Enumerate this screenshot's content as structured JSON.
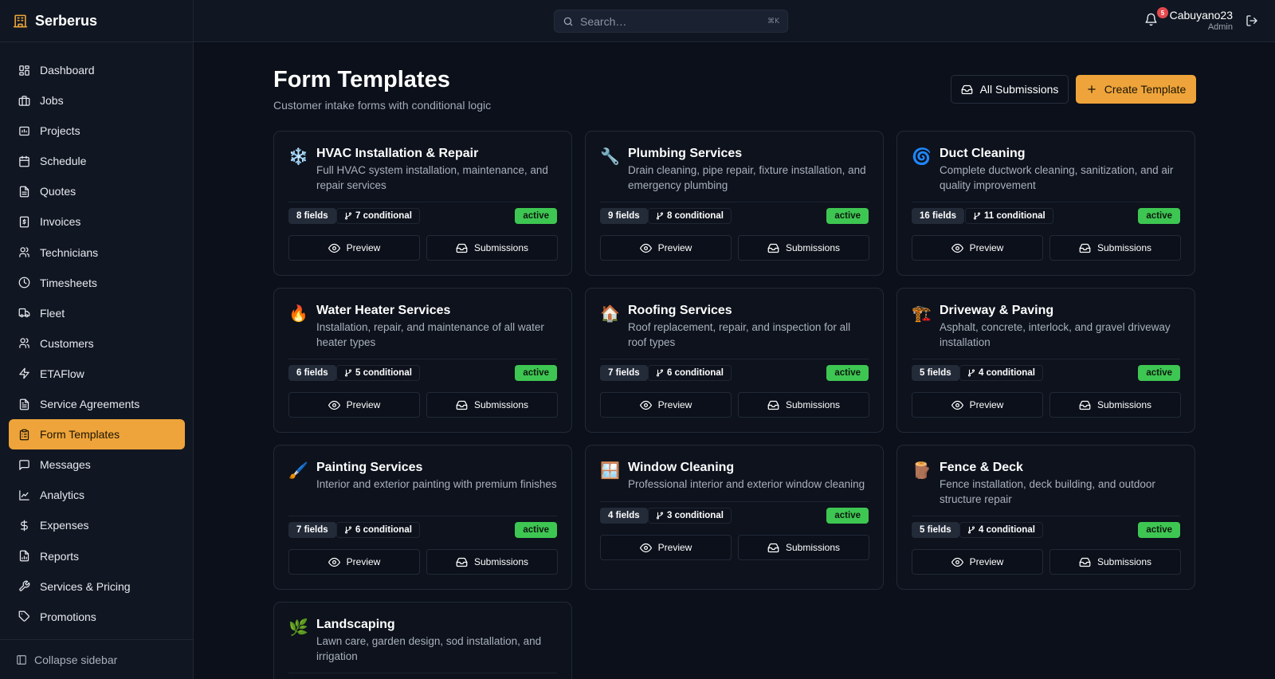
{
  "brand": {
    "name": "Serberus"
  },
  "sidebar": {
    "items": [
      {
        "label": "Dashboard",
        "icon": "dashboard-icon",
        "active": false
      },
      {
        "label": "Jobs",
        "icon": "briefcase-icon",
        "active": false
      },
      {
        "label": "Projects",
        "icon": "projects-icon",
        "active": false
      },
      {
        "label": "Schedule",
        "icon": "calendar-icon",
        "active": false
      },
      {
        "label": "Quotes",
        "icon": "document-icon",
        "active": false
      },
      {
        "label": "Invoices",
        "icon": "receipt-icon",
        "active": false
      },
      {
        "label": "Technicians",
        "icon": "users-icon",
        "active": false
      },
      {
        "label": "Timesheets",
        "icon": "clock-icon",
        "active": false
      },
      {
        "label": "Fleet",
        "icon": "truck-icon",
        "active": false
      },
      {
        "label": "Customers",
        "icon": "users-icon",
        "active": false
      },
      {
        "label": "ETAFlow",
        "icon": "lightning-icon",
        "active": false
      },
      {
        "label": "Service Agreements",
        "icon": "file-text-icon",
        "active": false
      },
      {
        "label": "Form Templates",
        "icon": "clipboard-icon",
        "active": true
      },
      {
        "label": "Messages",
        "icon": "message-icon",
        "active": false
      },
      {
        "label": "Analytics",
        "icon": "chart-line-icon",
        "active": false
      },
      {
        "label": "Expenses",
        "icon": "dollar-icon",
        "active": false
      },
      {
        "label": "Reports",
        "icon": "file-chart-icon",
        "active": false
      },
      {
        "label": "Services & Pricing",
        "icon": "wrench-icon",
        "active": false
      },
      {
        "label": "Promotions",
        "icon": "tag-icon",
        "active": false
      }
    ],
    "collapse_label": "Collapse sidebar"
  },
  "topbar": {
    "search_placeholder": "Search…",
    "search_shortcut": "⌘K",
    "notification_count": "5",
    "user_name": "Cabuyano23",
    "user_role": "Admin"
  },
  "page": {
    "title": "Form Templates",
    "subtitle": "Customer intake forms with conditional logic",
    "all_submissions_label": "All Submissions",
    "create_label": "Create Template"
  },
  "card_labels": {
    "preview": "Preview",
    "submissions": "Submissions"
  },
  "templates": [
    {
      "emoji": "❄️",
      "title": "HVAC Installation & Repair",
      "desc": "Full HVAC system installation, maintenance, and repair services",
      "fields": "8 fields",
      "conditional": "7 conditional",
      "status": "active"
    },
    {
      "emoji": "🔧",
      "title": "Plumbing Services",
      "desc": "Drain cleaning, pipe repair, fixture installation, and emergency plumbing",
      "fields": "9 fields",
      "conditional": "8 conditional",
      "status": "active"
    },
    {
      "emoji": "🌀",
      "title": "Duct Cleaning",
      "desc": "Complete ductwork cleaning, sanitization, and air quality improvement",
      "fields": "16 fields",
      "conditional": "11 conditional",
      "status": "active"
    },
    {
      "emoji": "🔥",
      "title": "Water Heater Services",
      "desc": "Installation, repair, and maintenance of all water heater types",
      "fields": "6 fields",
      "conditional": "5 conditional",
      "status": "active"
    },
    {
      "emoji": "🏠",
      "title": "Roofing Services",
      "desc": "Roof replacement, repair, and inspection for all roof types",
      "fields": "7 fields",
      "conditional": "6 conditional",
      "status": "active"
    },
    {
      "emoji": "🏗️",
      "title": "Driveway & Paving",
      "desc": "Asphalt, concrete, interlock, and gravel driveway installation",
      "fields": "5 fields",
      "conditional": "4 conditional",
      "status": "active"
    },
    {
      "emoji": "🖌️",
      "title": "Painting Services",
      "desc": "Interior and exterior painting with premium finishes",
      "fields": "7 fields",
      "conditional": "6 conditional",
      "status": "active"
    },
    {
      "emoji": "🪟",
      "title": "Window Cleaning",
      "desc": "Professional interior and exterior window cleaning",
      "fields": "4 fields",
      "conditional": "3 conditional",
      "status": "active"
    },
    {
      "emoji": "🪵",
      "title": "Fence & Deck",
      "desc": "Fence installation, deck building, and outdoor structure repair",
      "fields": "5 fields",
      "conditional": "4 conditional",
      "status": "active"
    },
    {
      "emoji": "🌿",
      "title": "Landscaping",
      "desc": "Lawn care, garden design, sod installation, and irrigation",
      "fields": "",
      "conditional": "",
      "status": ""
    }
  ],
  "colors": {
    "accent": "#eea43a",
    "active_badge": "#3ec652",
    "background": "#0b101a",
    "notification": "#e5484d"
  }
}
